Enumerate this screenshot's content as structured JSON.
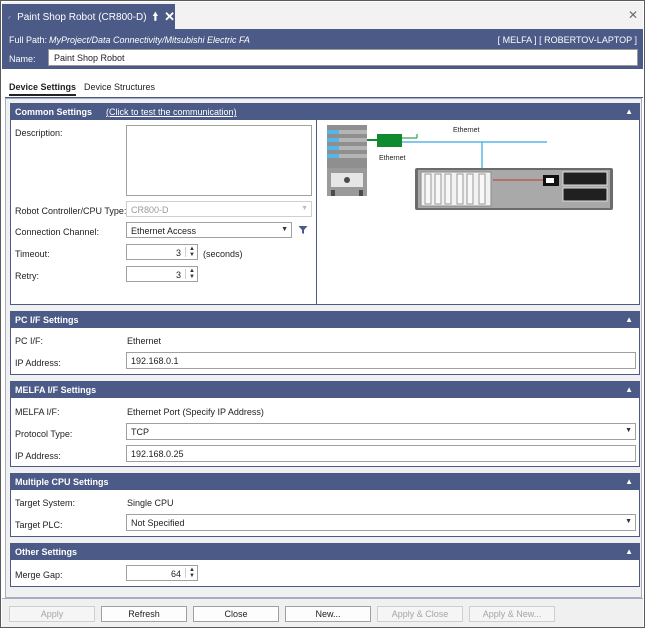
{
  "tab": {
    "title": "Paint Shop Robot (CR800-D)",
    "pin_icon": "pin-icon",
    "close_icon": "close-icon"
  },
  "path": {
    "label": "Full Path:",
    "value": "MyProject/Data Connectivity/Mitsubishi Electric FA",
    "host": "[ MELFA ] [ ROBERTOV-LAPTOP ]"
  },
  "name": {
    "label": "Name:",
    "value": "Paint Shop Robot"
  },
  "subtabs": {
    "settings": "Device Settings",
    "structures": "Device Structures"
  },
  "common": {
    "title": "Common Settings",
    "link": "(Click to test the communication)",
    "description_label": "Description:",
    "cpu_label": "Robot Controller/CPU Type:",
    "cpu_value": "CR800-D",
    "channel_label": "Connection Channel:",
    "channel_value": "Ethernet Access",
    "timeout_label": "Timeout:",
    "timeout_value": "3",
    "timeout_unit": "(seconds)",
    "retry_label": "Retry:",
    "retry_value": "3",
    "diagram_label1": "Ethernet",
    "diagram_label2": "Ethernet"
  },
  "pcif": {
    "title": "PC I/F Settings",
    "pcif_label": "PC I/F:",
    "pcif_value": "Ethernet",
    "ip_label": "IP Address:",
    "ip_value": "192.168.0.1"
  },
  "melfa": {
    "title": "MELFA I/F Settings",
    "if_label": "MELFA I/F:",
    "if_value": "Ethernet Port (Specify IP Address)",
    "protocol_label": "Protocol Type:",
    "protocol_value": "TCP",
    "ip_label": "IP Address:",
    "ip_value": "192.168.0.25"
  },
  "multicpu": {
    "title": "Multiple CPU Settings",
    "target_system_label": "Target System:",
    "target_system_value": "Single CPU",
    "target_plc_label": "Target PLC:",
    "target_plc_value": "Not Specified"
  },
  "other": {
    "title": "Other Settings",
    "merge_label": "Merge Gap:",
    "merge_value": "64"
  },
  "buttons": {
    "apply": "Apply",
    "refresh": "Refresh",
    "close": "Close",
    "new": "New...",
    "apply_close": "Apply & Close",
    "apply_new": "Apply & New..."
  },
  "colors": {
    "accent": "#4b5a86",
    "cable_green": "#0f8a2e",
    "ethernet_line": "#56b6e6"
  }
}
